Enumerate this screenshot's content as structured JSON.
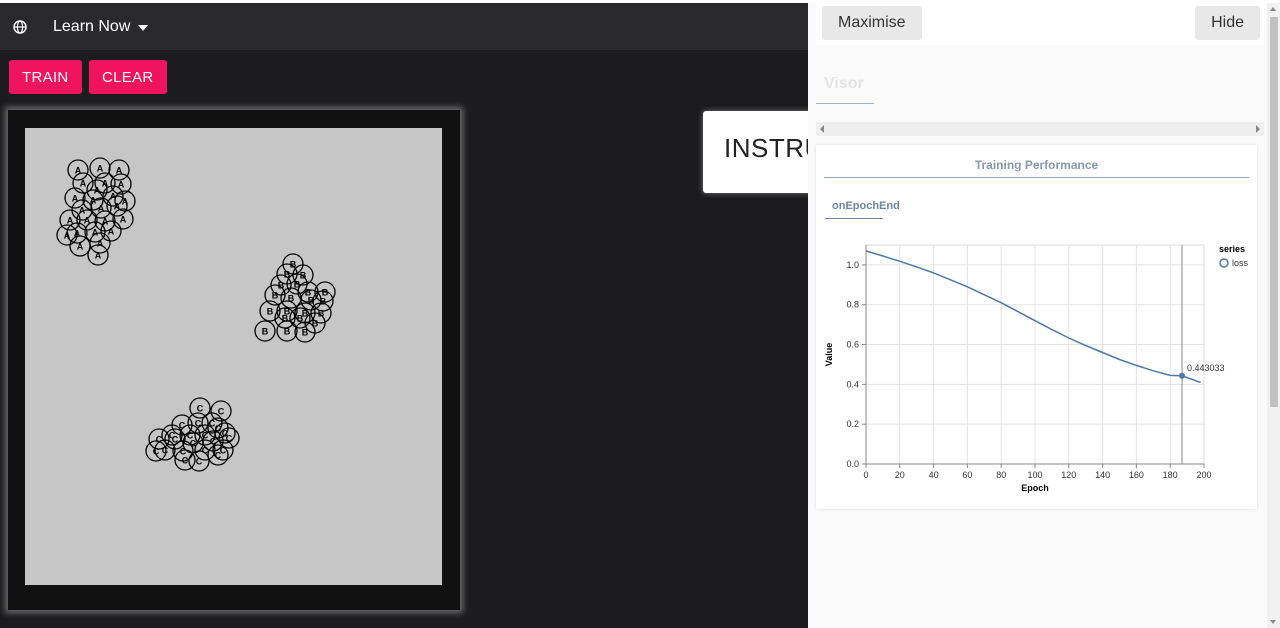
{
  "appbar": {
    "title": "Learn Now",
    "globe_icon": "globe-icon"
  },
  "toolbar": {
    "train_label": "TRAIN",
    "clear_label": "CLEAR",
    "accent": "#f0135d"
  },
  "instructions": {
    "label": "INSTRUCTIONS"
  },
  "canvas": {
    "clusters": [
      {
        "label": "A",
        "points": [
          [
            53,
            42
          ],
          [
            75,
            40
          ],
          [
            94,
            42
          ],
          [
            58,
            55
          ],
          [
            80,
            55
          ],
          [
            96,
            56
          ],
          [
            72,
            62
          ],
          [
            50,
            70
          ],
          [
            68,
            72
          ],
          [
            88,
            68
          ],
          [
            100,
            73
          ],
          [
            57,
            82
          ],
          [
            76,
            80
          ],
          [
            92,
            78
          ],
          [
            45,
            92
          ],
          [
            62,
            92
          ],
          [
            80,
            93
          ],
          [
            98,
            91
          ],
          [
            52,
            105
          ],
          [
            70,
            104
          ],
          [
            86,
            103
          ],
          [
            42,
            107
          ],
          [
            55,
            118
          ],
          [
            75,
            115
          ],
          [
            73,
            127
          ]
        ]
      },
      {
        "label": "B",
        "points": [
          [
            268,
            136
          ],
          [
            262,
            146
          ],
          [
            278,
            147
          ],
          [
            256,
            157
          ],
          [
            272,
            156
          ],
          [
            283,
            164
          ],
          [
            250,
            167
          ],
          [
            266,
            170
          ],
          [
            286,
            172
          ],
          [
            300,
            164
          ],
          [
            298,
            173
          ],
          [
            245,
            183
          ],
          [
            262,
            183
          ],
          [
            280,
            185
          ],
          [
            296,
            185
          ],
          [
            260,
            190
          ],
          [
            275,
            190
          ],
          [
            290,
            195
          ],
          [
            240,
            203
          ],
          [
            262,
            203
          ],
          [
            280,
            204
          ]
        ]
      },
      {
        "label": "C",
        "points": [
          [
            175,
            280
          ],
          [
            196,
            283
          ],
          [
            157,
            297
          ],
          [
            173,
            295
          ],
          [
            187,
            295
          ],
          [
            147,
            307
          ],
          [
            165,
            307
          ],
          [
            180,
            307
          ],
          [
            193,
            300
          ],
          [
            200,
            305
          ],
          [
            134,
            311
          ],
          [
            150,
            311
          ],
          [
            168,
            315
          ],
          [
            188,
            313
          ],
          [
            204,
            310
          ],
          [
            140,
            322
          ],
          [
            158,
            323
          ],
          [
            180,
            322
          ],
          [
            198,
            322
          ],
          [
            131,
            323
          ],
          [
            160,
            332
          ],
          [
            174,
            333
          ],
          [
            193,
            327
          ]
        ]
      }
    ]
  },
  "visor": {
    "maximise_label": "Maximise",
    "hide_label": "Hide",
    "tab_label": "Visor",
    "surface_title": "Training Performance",
    "subtab_label": "onEpochEnd"
  },
  "chart_data": {
    "type": "line",
    "xlabel": "Epoch",
    "ylabel": "Value",
    "xlim": [
      0,
      200
    ],
    "ylim": [
      0,
      1.1
    ],
    "xticks": [
      "0",
      "20",
      "40",
      "60",
      "80",
      "100",
      "120",
      "140",
      "160",
      "180",
      "200"
    ],
    "yticks": [
      "0.0",
      "0.2",
      "0.4",
      "0.6",
      "0.8",
      "1.0"
    ],
    "grid": true,
    "legend_title": "series",
    "legend_position": "top-right",
    "series": [
      {
        "name": "loss",
        "color": "#4c78a8",
        "x": [
          0,
          10,
          20,
          30,
          40,
          50,
          60,
          70,
          80,
          90,
          100,
          110,
          120,
          130,
          140,
          150,
          160,
          170,
          180,
          187,
          198
        ],
        "y": [
          1.07,
          1.045,
          1.018,
          0.99,
          0.96,
          0.925,
          0.89,
          0.85,
          0.81,
          0.765,
          0.72,
          0.675,
          0.633,
          0.595,
          0.56,
          0.525,
          0.495,
          0.468,
          0.445,
          0.443,
          0.41
        ]
      }
    ],
    "annotation": {
      "x": 187,
      "y": 0.443,
      "text": "0.443033"
    }
  }
}
